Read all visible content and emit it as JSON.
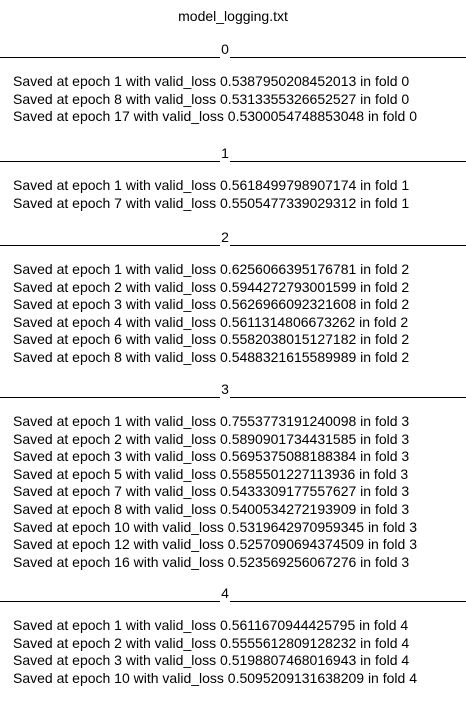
{
  "title": "model_logging.txt",
  "folds": [
    {
      "label": "0",
      "lines": [
        "Saved at epoch 1 with valid_loss 0.5387950208452013 in fold 0",
        "Saved at epoch 8 with valid_loss 0.5313355326652527 in fold 0",
        "Saved at epoch 17 with valid_loss 0.5300054748853048 in fold 0"
      ]
    },
    {
      "label": "1",
      "lines": [
        "Saved at epoch 1 with valid_loss 0.5618499798907174 in fold 1",
        "Saved at epoch 7 with valid_loss 0.5505477339029312 in fold 1"
      ]
    },
    {
      "label": "2",
      "lines": [
        "Saved at epoch 1 with valid_loss 0.6256066395176781 in fold 2",
        "Saved at epoch 2 with valid_loss 0.5944272793001599 in fold 2",
        "Saved at epoch 3 with valid_loss 0.5626966092321608 in fold 2",
        "Saved at epoch 4 with valid_loss 0.5611314806673262 in fold 2",
        "Saved at epoch 6 with valid_loss 0.5582038015127182 in fold 2",
        "Saved at epoch 8 with valid_loss 0.5488321615589989 in fold 2"
      ]
    },
    {
      "label": "3",
      "lines": [
        "Saved at epoch 1 with valid_loss 0.7553773191240098 in fold 3",
        "Saved at epoch 2 with valid_loss 0.5890901734431585 in fold 3",
        "Saved at epoch 3 with valid_loss 0.5695375088188384 in fold 3",
        "Saved at epoch 5 with valid_loss 0.5585501227113936 in fold 3",
        "Saved at epoch 7 with valid_loss 0.5433309177557627 in fold 3",
        "Saved at epoch 8 with valid_loss 0.5400534272193909 in fold 3",
        "Saved at epoch 10 with valid_loss 0.5319642970959345 in fold 3",
        "Saved at epoch 12 with valid_loss 0.5257090694374509 in fold 3",
        "Saved at epoch 16 with valid_loss 0.523569256067276 in fold 3"
      ]
    },
    {
      "label": "4",
      "lines": [
        "Saved at epoch 1 with valid_loss 0.5611670944425795 in fold 4",
        "Saved at epoch 2 with valid_loss 0.5555612809128232 in fold 4",
        "Saved at epoch 3 with valid_loss 0.5198807468016943 in fold 4",
        "Saved at epoch 10 with valid_loss 0.5095209131638209 in fold 4"
      ]
    }
  ]
}
